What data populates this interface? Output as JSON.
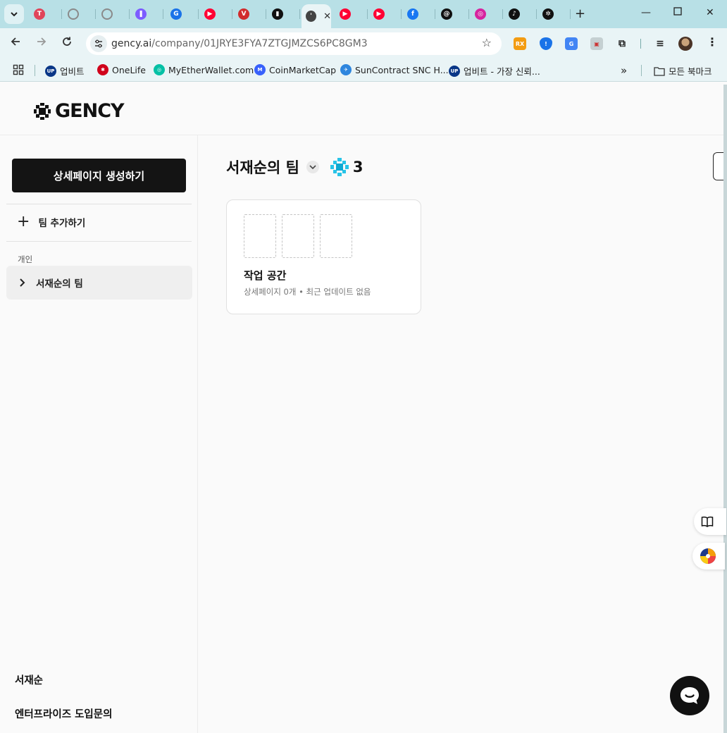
{
  "browser": {
    "tabs": [
      {
        "name": "tab-1",
        "color": "#e0455a",
        "glyph": "T"
      },
      {
        "name": "tab-2",
        "color": "#8a8a8a",
        "glyph": ""
      },
      {
        "name": "tab-3",
        "color": "#8a8a8a",
        "glyph": ""
      },
      {
        "name": "tab-4",
        "color": "#7c5cff",
        "glyph": "❚"
      },
      {
        "name": "tab-5",
        "color": "#1a73e8",
        "glyph": "G"
      },
      {
        "name": "tab-6",
        "color": "#ff0033",
        "glyph": "▶"
      },
      {
        "name": "tab-7",
        "color": "#d12c2c",
        "glyph": "V"
      },
      {
        "name": "tab-8",
        "color": "#111111",
        "glyph": "▮"
      },
      {
        "name": "tab-active",
        "color": "#444444",
        "glyph": "'",
        "active": true
      },
      {
        "name": "tab-10",
        "color": "#ff0033",
        "glyph": "▶"
      },
      {
        "name": "tab-11",
        "color": "#ff0033",
        "glyph": "▶"
      },
      {
        "name": "tab-12",
        "color": "#1877f2",
        "glyph": "f"
      },
      {
        "name": "tab-13",
        "color": "#111111",
        "glyph": "@"
      },
      {
        "name": "tab-14",
        "color": "#d6249f",
        "glyph": "◎"
      },
      {
        "name": "tab-15",
        "color": "#111111",
        "glyph": "♪"
      },
      {
        "name": "tab-16",
        "color": "#111111",
        "glyph": "✲"
      }
    ],
    "url_host": "gency.ai",
    "url_path": "/company/01JRYE3FYA7ZTGJMZCS6PC8GM3",
    "bookmarks": [
      {
        "label": "업비트",
        "icon_color": "#093687",
        "glyph": "UP"
      },
      {
        "label": "OneLife",
        "icon_color": "#d0021b",
        "glyph": "✱"
      },
      {
        "label": "MyEtherWallet.com",
        "icon_color": "#05c0a5",
        "glyph": "◎"
      },
      {
        "label": "CoinMarketCap",
        "icon_color": "#3861fb",
        "glyph": "M"
      },
      {
        "label": "SunContract SNC H...",
        "icon_color": "#2e86de",
        "glyph": "✈"
      },
      {
        "label": "업비트 - 가장 신뢰...",
        "icon_color": "#093687",
        "glyph": "UP"
      }
    ],
    "all_bookmarks_label": "모든 북마크",
    "overflow_label": "»"
  },
  "app": {
    "logo_text": "GENCY",
    "create_button_label": "상세페이지 생성하기",
    "add_team_label": "팀 추가하기",
    "section_label": "개인",
    "team_item_label": "서재순의 팀",
    "user_name": "서재순",
    "enterprise_link": "엔터프라이즈 도입문의",
    "page_title": "서재순의 팀",
    "credit_count": "3",
    "workspace": {
      "title": "작업 공간",
      "meta": "상세페이지 0개 • 최근 업데이트 없음"
    }
  }
}
